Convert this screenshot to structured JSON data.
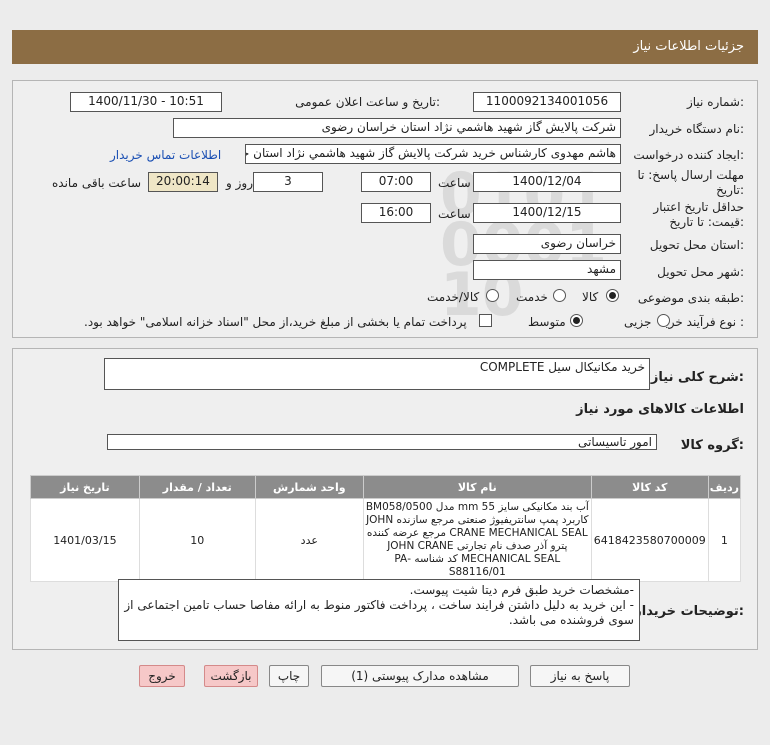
{
  "header": {
    "title": "جزئیات اطلاعات نیاز"
  },
  "fields": {
    "need_number_label": "شماره نیاز:",
    "need_number": "1100092134001056",
    "announce_label": "تاریخ و ساعت اعلان عمومی:",
    "announce_value": "1400/11/30 - 10:51",
    "buyer_org_label": "نام دستگاه خریدار:",
    "buyer_org": "شرکت پالایش گاز شهید هاشمي نژاد   استان خراسان رضوی",
    "creator_label": "ایجاد کننده درخواست:",
    "creator": "هاشم مهدوی کارشناس خرید شرکت پالایش گاز شهید هاشمي نژاد   استان خراسان رضوی",
    "contact_link": "اطلاعات تماس خریدار",
    "reply_deadline_label": "مهلت ارسال پاسخ: تا تاریخ:",
    "reply_date": "1400/12/04",
    "time_label": "ساعت",
    "reply_time": "07:00",
    "days_value": "3",
    "days_label": "روز و",
    "remaining_time": "20:00:14",
    "remaining_label": "ساعت باقی مانده",
    "validity_label": "حداقل تاریخ اعتبار قیمت: تا تاریخ:",
    "validity_date": "1400/12/15",
    "validity_time": "16:00",
    "province_label": "استان محل تحویل:",
    "province": "خراسان رضوی",
    "city_label": "شهر محل تحویل:",
    "city": "مشهد",
    "category_label": "طبقه بندی موضوعی:",
    "category_options": [
      "کالا",
      "خدمت",
      "کالا/خدمت"
    ],
    "process_label": "نوع فرآیند خرید :",
    "process_options": [
      "جزیی",
      "متوسط"
    ],
    "payment_note": "پرداخت تمام یا بخشی از مبلغ خرید،از محل \"اسناد خزانه اسلامی\" خواهد بود."
  },
  "summary": {
    "label": "شرح کلی نیاز:",
    "value": "خرید مکانیکال سیل COMPLETE",
    "goods_info_title": "اطلاعات کالاهای مورد نیاز",
    "group_label": "گروه کالا:",
    "group_value": "امور تاسیساتی"
  },
  "table": {
    "headers": [
      "ردیف",
      "کد کالا",
      "نام کالا",
      "واحد شمارش",
      "تعداد / مقدار",
      "تاریخ نیاز"
    ],
    "rows": [
      {
        "index": "1",
        "code": "6418423580700009",
        "name": "آب بند مکانیکی سایز mm 55 مدل BM058/0500 کاربرد پمپ سانتریفیوژ صنعتی مرجع سازنده JOHN CRANE MECHANICAL SEAL مرجع عرضه کننده پترو آذر صدف نام تجارتی JOHN CRANE MECHANICAL SEAL کد شناسه -PA S88116/01",
        "unit": "عدد",
        "qty": "10",
        "date": "1401/03/15"
      }
    ]
  },
  "buyer_notes": {
    "label": "توضیحات خریدار:",
    "lines": [
      "-مشخصات خرید طبق فرم دیتا شیت پیوست.",
      "- این خرید به دلیل داشتن فرایند ساخت ، پرداخت فاکتور منوط به ارائه مفاصا حساب تامین اجتماعی از سوی فروشنده می باشد."
    ]
  },
  "buttons": {
    "reply": "پاسخ به نیاز",
    "attachments": "مشاهده مدارک پیوستی (1)",
    "print": "چاپ",
    "back": "بازگشت",
    "exit": "خروج"
  }
}
